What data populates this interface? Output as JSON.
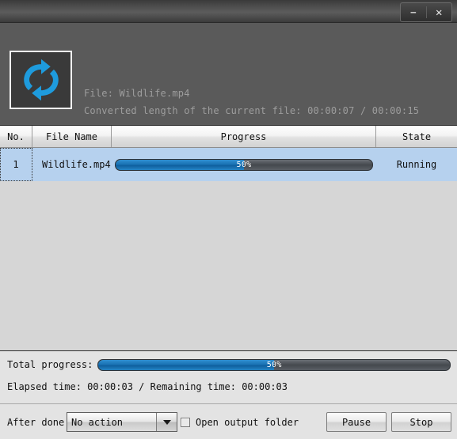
{
  "window": {
    "title": "",
    "controls": {
      "minimize": "–",
      "close": "✕"
    }
  },
  "header": {
    "icon": "convert-refresh-icon",
    "file_line": "File: Wildlife.mp4",
    "converted_line": "Converted length of the current file: 00:00:07 / 00:00:15",
    "file_label": "File:",
    "file_name": "Wildlife.mp4",
    "converted_label": "Converted length of the current file:",
    "converted_elapsed": "00:00:07",
    "converted_total": "00:00:15"
  },
  "list": {
    "columns": [
      "No.",
      "File Name",
      "Progress",
      "State"
    ],
    "rows": [
      {
        "no": "1",
        "file_name": "Wildlife.mp4",
        "progress_percent": 50,
        "progress_label": "50%",
        "state": "Running"
      }
    ]
  },
  "total": {
    "label": "Total progress:",
    "percent": 50,
    "percent_label": "50%",
    "times_line": "Elapsed time: 00:00:03 / Remaining time: 00:00:03",
    "elapsed_label": "Elapsed time:",
    "elapsed_value": "00:00:03",
    "remaining_label": "Remaining time:",
    "remaining_value": "00:00:03"
  },
  "controls": {
    "after_done_label": "After done:",
    "after_done_value": "No action",
    "after_done_options": [
      "No action"
    ],
    "open_output_label": "Open output folder",
    "open_output_checked": false,
    "pause_label": "Pause",
    "stop_label": "Stop"
  },
  "colors": {
    "titlebar": "#4e4e4e",
    "header_panel": "#5a5a5a",
    "list_background": "#d6d6d6",
    "row_selected": "#b6d1ee",
    "progress_fill": "#1a72b4",
    "progress_track": "#4a4f54",
    "bottom_panel": "#e3e3e3",
    "icon_blue": "#1e9bdd"
  }
}
